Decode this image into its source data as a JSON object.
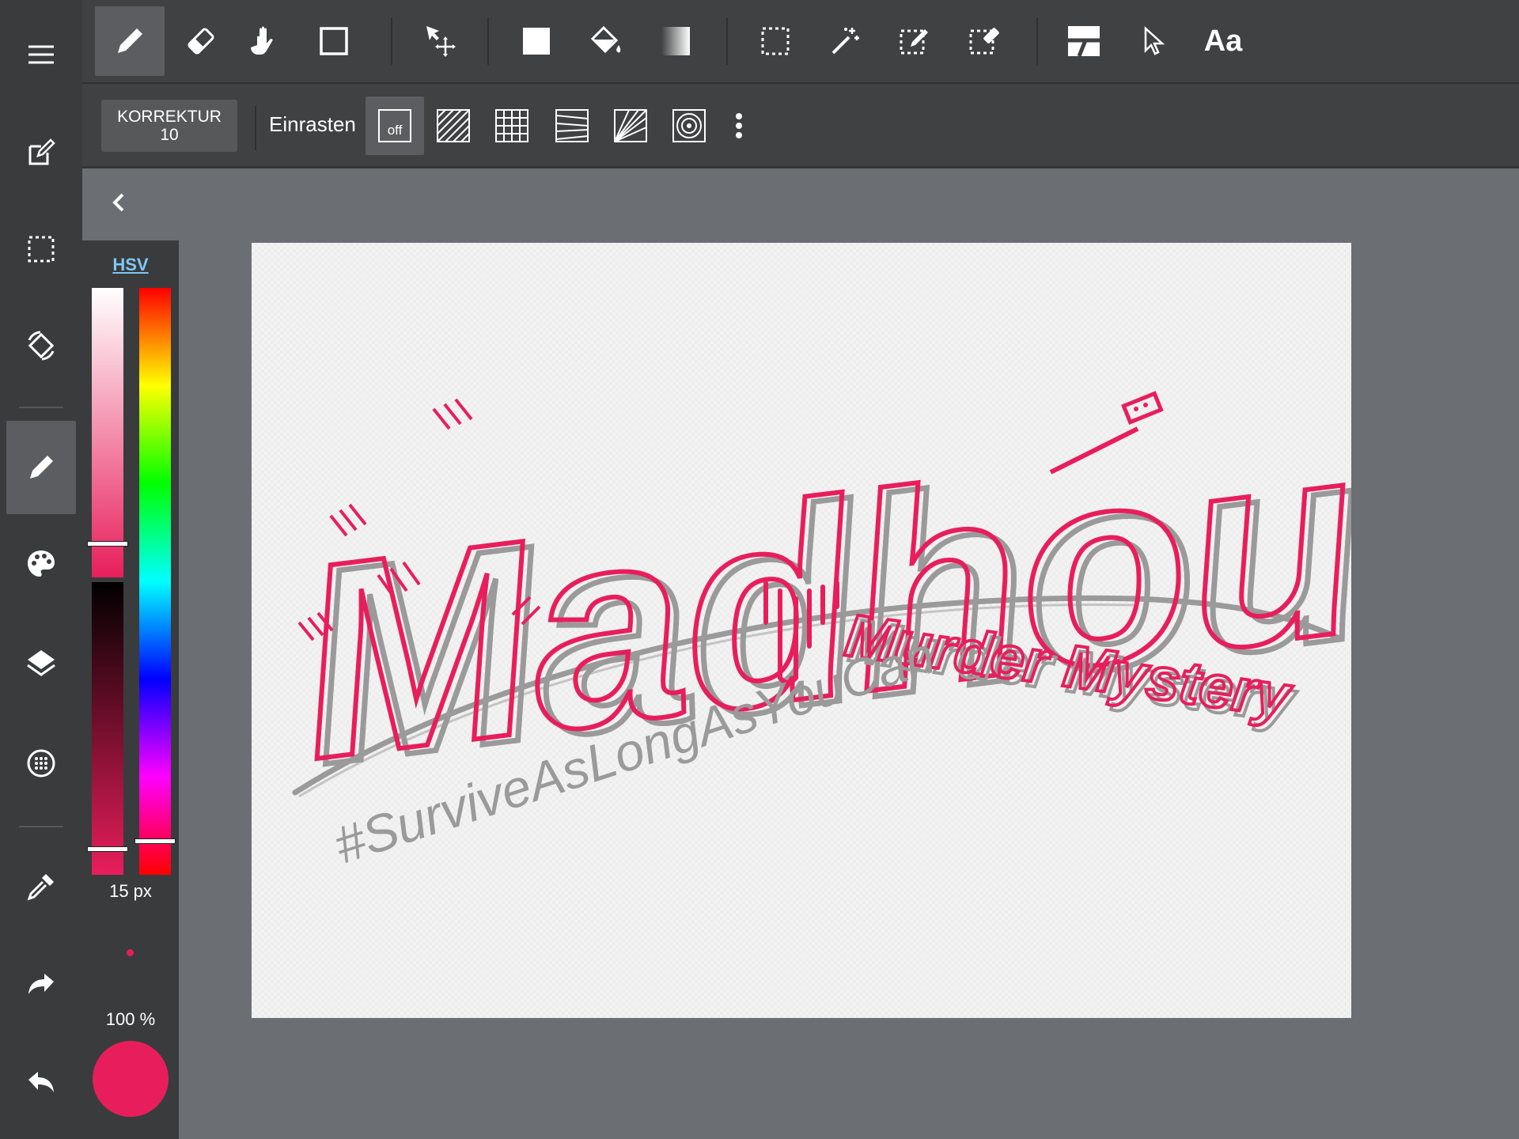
{
  "toolbar": {
    "tools": [
      "brush",
      "eraser",
      "hand",
      "shape",
      "move",
      "fill-rect",
      "bucket",
      "gradient",
      "select-rect",
      "magic-wand",
      "select-pen",
      "select-eraser",
      "panel",
      "pointer",
      "text"
    ],
    "text_tool_label": "Aa",
    "active_tool": "brush"
  },
  "options": {
    "correction_label": "KORREKTUR",
    "correction_value": "10",
    "snap_label": "Einrasten",
    "snap_off_label": "off"
  },
  "color_panel": {
    "mode_label": "HSV",
    "brush_size": "15 px",
    "opacity": "100 %",
    "current_color": "#e81e5c"
  },
  "left_rail": {
    "items": [
      "menu",
      "edit",
      "selection",
      "rotate",
      "brush",
      "palette",
      "layers",
      "material",
      "eyedropper",
      "redo",
      "undo"
    ],
    "active_item": "brush"
  },
  "canvas": {
    "title_text": "Madhouse",
    "subtitle_text": "Murder Mystery",
    "tagline_text": "#SurviveAsLongAsYouCan"
  },
  "colors": {
    "accent": "#e81e5c",
    "sketch_gray": "#a0a0a0",
    "toolbar_bg": "#404142",
    "rail_bg": "#3a3b3d",
    "workspace_bg": "#6b6e73"
  }
}
